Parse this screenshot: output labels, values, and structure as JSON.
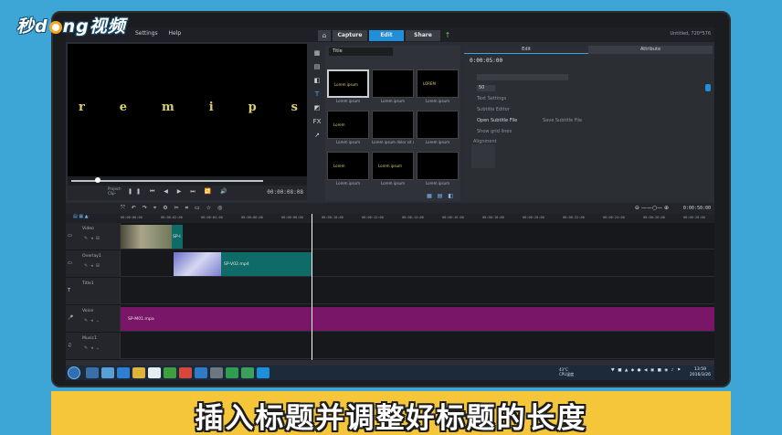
{
  "watermark": {
    "text_before": "秒d",
    "text_after": "ng视频"
  },
  "app": {
    "menu": [
      "Settings",
      "Help"
    ],
    "tabs": [
      "Capture",
      "Edit",
      "Share"
    ],
    "active_tab": "Edit",
    "project_name": "Untitled, 720*576"
  },
  "preview": {
    "letters": [
      "r",
      "e",
      "m",
      "i",
      "p",
      "s"
    ],
    "project_clip_label": [
      "Project-",
      "Clip-"
    ],
    "timecode": "00:00:08:08"
  },
  "library": {
    "category": "Title",
    "thumbs": [
      {
        "text": "Lorem ipsum",
        "label": "Lorem ipsum"
      },
      {
        "text": "",
        "label": "Lorem ipsum"
      },
      {
        "text": "LOREM",
        "label": "Lorem ipsum"
      },
      {
        "text": "Lorem",
        "label": "Lorem ipsum"
      },
      {
        "text": "",
        "label": "Lorem ipsum dolor sit am..."
      },
      {
        "text": "",
        "label": "Lorem ipsum"
      },
      {
        "text": "Lorem",
        "label": "Lorem ipsum"
      },
      {
        "text": "Lorem ipsum",
        "label": "Lorem ipsum"
      },
      {
        "text": "",
        "label": "Lorem ipsum"
      }
    ]
  },
  "options": {
    "tab_edit": "Edit",
    "tab_attribute": "Attribute",
    "duration": "0:00:05:00",
    "font_size": "50",
    "rows": [
      "Text Settings",
      "Subtitle Editor",
      "Open Subtitle File",
      "Save Subtitle File",
      "Show grid lines",
      "Alignment"
    ]
  },
  "timeline": {
    "timecode": "0:00:50:00",
    "ruler": [
      "00:00:00:00",
      "00:00:02:00",
      "00:00:04:00",
      "00:00:06:00",
      "00:00:08:00",
      "00:00:10:00",
      "00:00:12:00",
      "00:00:14:00",
      "00:00:16:00",
      "00:00:18:00",
      "00:00:20:00",
      "00:00:22:00",
      "00:00:24:00",
      "00:00:26:00",
      "00:00:28:00"
    ],
    "tracks": [
      {
        "name": "Video",
        "clip": "SP-I"
      },
      {
        "name": "Overlay1",
        "clip": "SP-V02.mp4"
      },
      {
        "name": "Title1",
        "clip": ""
      },
      {
        "name": "Voice",
        "clip": "SP-M01.mpa"
      },
      {
        "name": "Music1",
        "clip": ""
      }
    ]
  },
  "taskbar": {
    "weather": [
      "43°C",
      "CPU温度"
    ],
    "time": "13:59",
    "date": "2016/3/26"
  },
  "caption": "插入标题并调整好标题的长度",
  "colors": {
    "accent": "#1f8fd9",
    "overlay_clip": "#0e6b68",
    "voice_clip": "#7a1668",
    "caption_bg": "#f6c63a"
  }
}
